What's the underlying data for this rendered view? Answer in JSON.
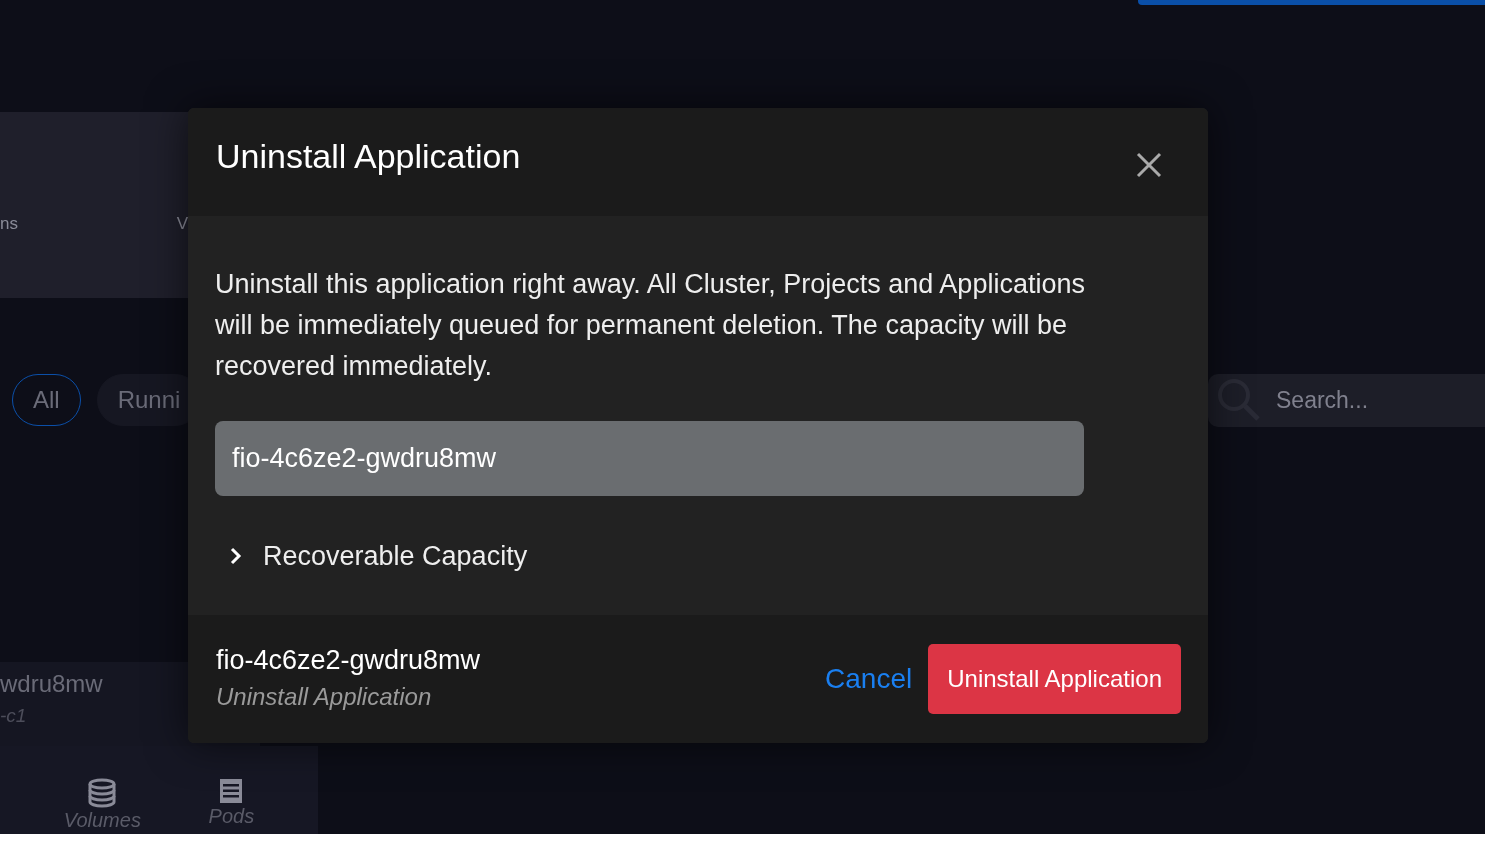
{
  "background": {
    "summary_card": {
      "label_1": "ns",
      "label_2": "V"
    },
    "filters": [
      {
        "label": "All",
        "selected": true
      },
      {
        "label": "Runni",
        "selected": false
      }
    ],
    "search": {
      "placeholder": "Search..."
    },
    "list_item": {
      "name": "wdru8mw",
      "subtitle": "-c1"
    },
    "bottom_tabs": [
      {
        "label": "Volumes",
        "kind": "volumes"
      },
      {
        "label": "Pods",
        "kind": "pods"
      }
    ]
  },
  "dialog": {
    "title": "Uninstall Application",
    "message": "Uninstall this application right away. All Cluster, Projects and Applications will be immediately queued for permanent deletion. The capacity will be recovered immediately.",
    "input": {
      "value": "fio-4c6ze2-gwdru8mw"
    },
    "expander": {
      "label": "Recoverable Capacity",
      "expanded": false
    },
    "footer": {
      "name": "fio-4c6ze2-gwdru8mw",
      "action": "Uninstall Application"
    },
    "buttons": [
      {
        "label": "Cancel",
        "kind": "link"
      },
      {
        "label": "Uninstall Application",
        "kind": "danger"
      }
    ]
  }
}
